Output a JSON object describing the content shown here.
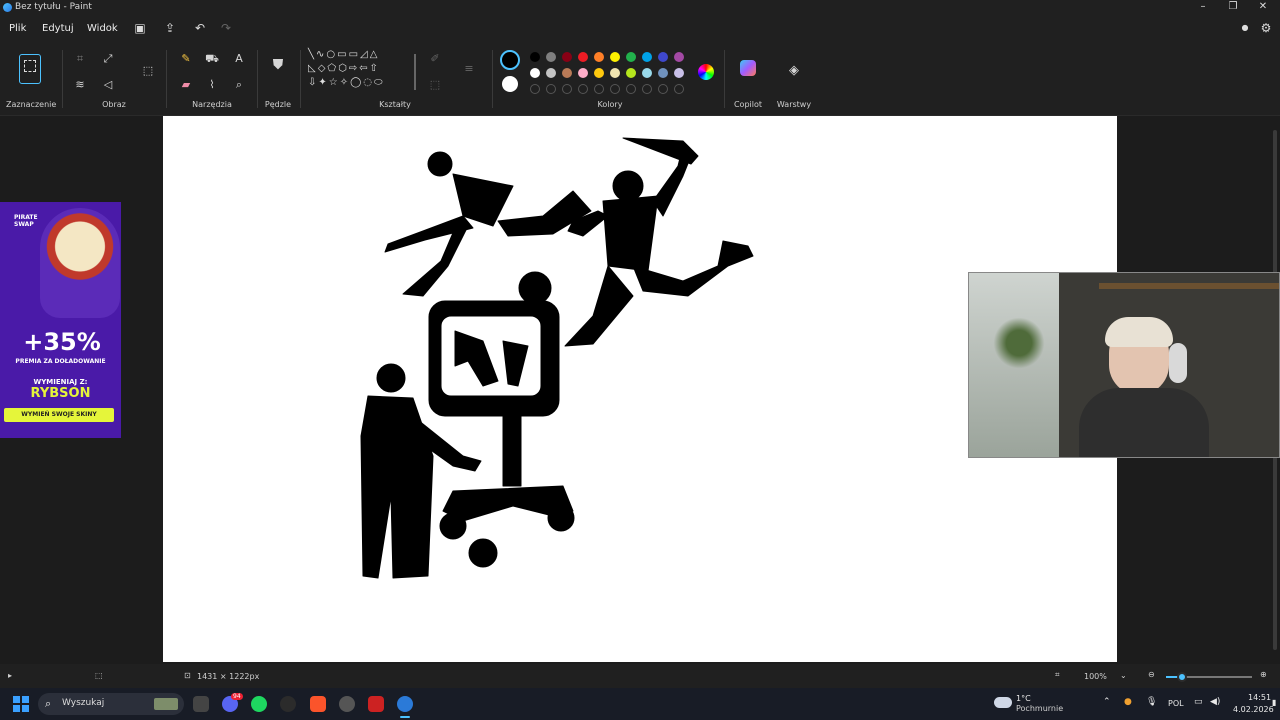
{
  "window": {
    "title": "Bez tytułu - Paint"
  },
  "menu": {
    "items": [
      "Plik",
      "Edytuj",
      "Widok"
    ]
  },
  "ribbon": {
    "groups": {
      "selection": "Zaznaczenie",
      "image": "Obraz",
      "tools": "Narzędzia",
      "brushes": "Pędzle",
      "shapes": "Kształty",
      "colors": "Kolory",
      "copilot": "Copilot",
      "layers": "Warstwy"
    }
  },
  "palette": {
    "primary": "#000000",
    "secondary": "#ffffff",
    "row1": [
      "#000000",
      "#7f7f7f",
      "#880015",
      "#ed1c24",
      "#ff7f27",
      "#fff200",
      "#22b14c",
      "#00a2e8",
      "#3f48cc",
      "#a349a4"
    ],
    "row2": [
      "#ffffff",
      "#c3c3c3",
      "#b97a57",
      "#ffaec9",
      "#ffc90e",
      "#efe4b0",
      "#b5e61d",
      "#99d9ea",
      "#7092be",
      "#c8bfe7"
    ]
  },
  "ad": {
    "brand": "PIRATE SWAP",
    "headline": "+35%",
    "subtitle": "PREMIA ZA DOŁADOWANIE",
    "code_label": "WYMIENIAJ Z:",
    "code": "RYBSON",
    "cta": "WYMIEŃ SWOJE SKINY"
  },
  "status": {
    "dimensions": "1431 × 1222px",
    "zoom": "100%"
  },
  "taskbar": {
    "search_placeholder": "Wyszukaj",
    "weather_temp": "1°C",
    "weather_desc": "Pochmurnie",
    "language": "POL",
    "time": "14:51",
    "date": "4.02.2026",
    "discord_badge": "94"
  },
  "colors": {
    "accent": "#4cc2ff",
    "bg": "#1c1c1c",
    "ribbon_bg": "#202020",
    "taskbar_bg": "#181c26",
    "ad_bg": "#4a1aa8",
    "ad_yellow": "#e5f53a"
  }
}
